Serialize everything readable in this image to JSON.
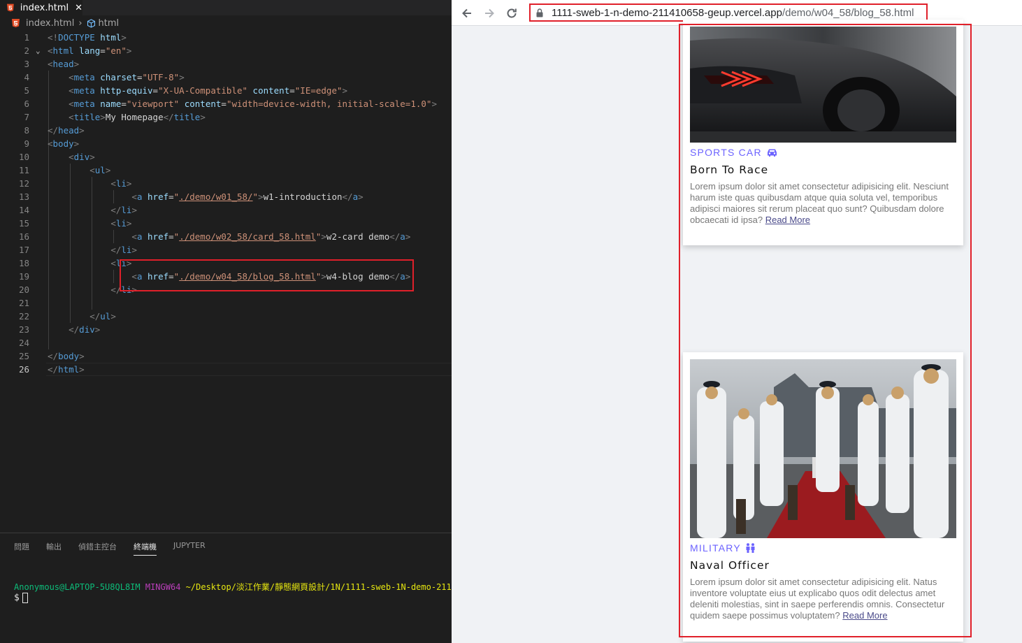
{
  "editor": {
    "tab_label": "index.html",
    "breadcrumb": {
      "file": "index.html",
      "symbol": "html"
    },
    "line_numbers": [
      "1",
      "2",
      "3",
      "4",
      "5",
      "6",
      "7",
      "8",
      "9",
      "10",
      "11",
      "12",
      "13",
      "14",
      "15",
      "16",
      "17",
      "18",
      "19",
      "20",
      "21",
      "22",
      "23",
      "24",
      "25",
      "26"
    ],
    "code": {
      "l1": {
        "open": "<!",
        "tag": "DOCTYPE",
        "rest": " html",
        "close": ">"
      },
      "l2": {
        "tag": "html",
        "attr": "lang",
        "val": "\"en\""
      },
      "l3": {
        "tag": "head"
      },
      "l4": {
        "tag": "meta",
        "attr": "charset",
        "val": "\"UTF-8\""
      },
      "l5": {
        "tag": "meta",
        "attr1": "http-equiv",
        "val1": "\"X-UA-Compatible\"",
        "attr2": "content",
        "val2": "\"IE=edge\""
      },
      "l6": {
        "tag": "meta",
        "attr1": "name",
        "val1": "\"viewport\"",
        "attr2": "content",
        "val2": "\"width=device-width, initial-scale=1.0\""
      },
      "l7": {
        "tag": "title",
        "text": "My Homepage"
      },
      "l8": {
        "tag": "head"
      },
      "l9": {
        "tag": "body"
      },
      "l10": {
        "tag": "div"
      },
      "l11": {
        "tag": "ul"
      },
      "l12": {
        "tag": "li"
      },
      "l13": {
        "tag": "a",
        "attr": "href",
        "url": "./demo/w01_58/",
        "text": "w1-introduction"
      },
      "l14": {
        "tag": "li"
      },
      "l15": {
        "tag": "li"
      },
      "l16": {
        "tag": "a",
        "attr": "href",
        "url": "./demo/w02_58/card_58.html",
        "text": "w2-card demo"
      },
      "l17": {
        "tag": "li"
      },
      "l18": {
        "tag": "li"
      },
      "l19": {
        "tag": "a",
        "attr": "href",
        "url": "./demo/w04_58/blog_58.html",
        "text": "w4-blog demo"
      },
      "l20": {
        "tag": "li"
      },
      "l22": {
        "tag": "ul"
      },
      "l23": {
        "tag": "div"
      },
      "l25": {
        "tag": "body"
      },
      "l26": {
        "tag": "html"
      }
    }
  },
  "panel": {
    "tabs": [
      "問題",
      "輸出",
      "偵錯主控台",
      "終端機",
      "JUPYTER"
    ],
    "active_tab": "終端機",
    "terminal": {
      "user": "Anonymous@LAPTOP-5U8QL8IM",
      "shell": "MINGW64",
      "path": "~/Desktop/淡江作業/靜態網頁設計/1N/1111-sweb-1N-demo-211",
      "prompt": "$"
    }
  },
  "browser": {
    "url_host": "1111-sweb-1-n-demo-211410658-geup.vercel.app",
    "url_path": "/demo/w04_58/blog_58.html",
    "cards": [
      {
        "category": "SPORTS CAR",
        "category_icon": "car-icon",
        "title": "Born To Race",
        "description": "Lorem ipsum dolor sit amet consectetur adipisicing elit. Nesciunt harum iste quas quibusdam atque quia soluta vel, temporibus adipisci maiores sit rerum placeat quo sunt? Quibusdam dolore obcaecati id ipsa?",
        "link": "Read More"
      },
      {
        "category": "MILITARY",
        "category_icon": "people-icon",
        "title": "Naval Officer",
        "description": "Lorem ipsum dolor sit amet consectetur adipisicing elit. Natus inventore voluptate eius ut explicabo quos odit delectus amet deleniti molestias, sint in saepe perferendis omnis. Consectetur quidem saepe possimus voluptatem?",
        "link": "Read More"
      }
    ]
  },
  "colors": {
    "accent": "#6c63ff",
    "highlight_box": "#e0202a",
    "editor_bg": "#1e1e1e"
  }
}
